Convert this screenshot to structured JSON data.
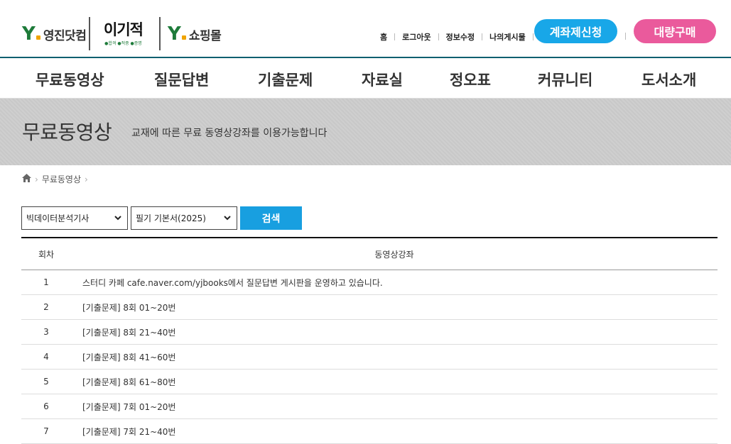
{
  "header": {
    "logos": {
      "logo1_text": "영진닷컴",
      "logo2_main": "이기적",
      "logo2_sub": "●합격 ●적중 ●증명",
      "logo3_text": "쇼핑몰"
    },
    "util_links": [
      "홈",
      "로그아웃",
      "정보수정",
      "나의게시물"
    ],
    "account_button": "계좌제신청",
    "bulk_button": "대량구매"
  },
  "nav": {
    "items": [
      "무료동영상",
      "질문답변",
      "기출문제",
      "자료실",
      "정오표",
      "커뮤니티",
      "도서소개"
    ]
  },
  "banner": {
    "title": "무료동영상",
    "description": "교재에 따른 무료 동영상강좌를 이용가능합니다"
  },
  "breadcrumb": {
    "current": "무료동영상"
  },
  "search": {
    "category_selected": "빅데이터분석기사",
    "book_selected": "필기 기본서(2025)",
    "button_label": "검색"
  },
  "table": {
    "headers": [
      "회차",
      "동영상강좌"
    ],
    "rows": [
      {
        "num": "1",
        "title": "스터디 카페 cafe.naver.com/yjbooks에서 질문답변 게시판을 운영하고 있습니다."
      },
      {
        "num": "2",
        "title": "[기출문제] 8회 01~20번"
      },
      {
        "num": "3",
        "title": "[기출문제] 8회 21~40번"
      },
      {
        "num": "4",
        "title": "[기출문제] 8회 41~60번"
      },
      {
        "num": "5",
        "title": "[기출문제] 8회 61~80번"
      },
      {
        "num": "6",
        "title": "[기출문제] 7회 01~20번"
      },
      {
        "num": "7",
        "title": "[기출문제] 7회 21~40번"
      }
    ]
  },
  "colors": {
    "brand_green": "#1e7b3a",
    "accent_blue": "#18a7e8",
    "accent_pink": "#ea5a9c",
    "header_line": "#0f5f6f"
  }
}
